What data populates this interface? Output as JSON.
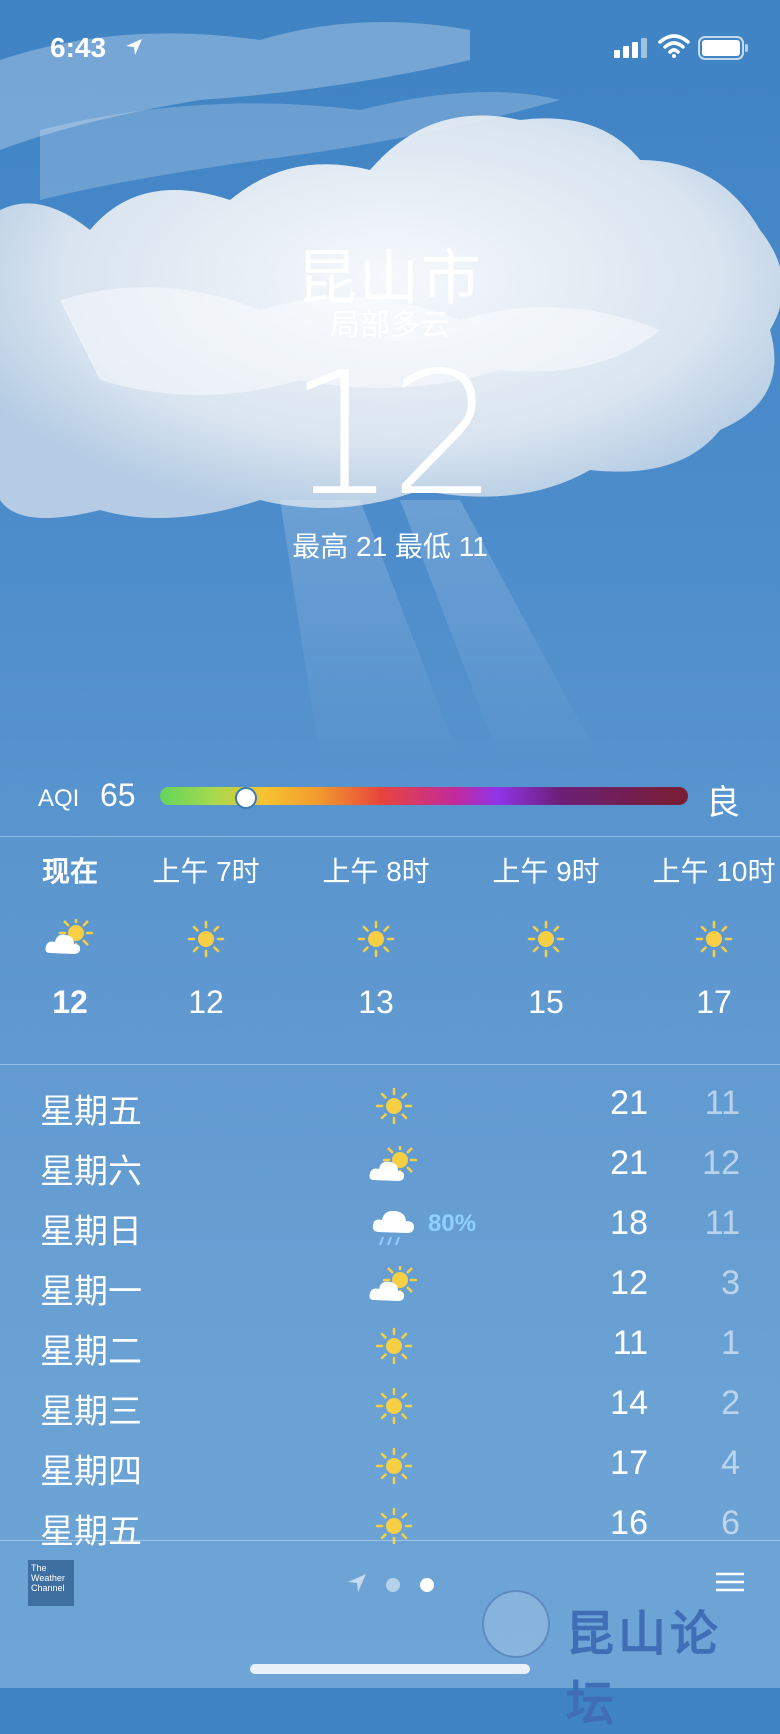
{
  "status_bar": {
    "time": "6:43"
  },
  "location": {
    "city": "昆山市",
    "condition": "局部多云",
    "temperature": "12",
    "hi_lo": "最高 21  最低 11"
  },
  "aqi": {
    "label": "AQI",
    "value": "65",
    "level": "良",
    "position": 0.16
  },
  "hourly": [
    {
      "label": "现在",
      "icon": "partly-cloudy-icon",
      "temp": "12",
      "bold": true
    },
    {
      "label": "上午 7时",
      "icon": "sun-icon",
      "temp": "12"
    },
    {
      "label": "上午 8时",
      "icon": "sun-icon",
      "temp": "13"
    },
    {
      "label": "上午 9时",
      "icon": "sun-icon",
      "temp": "15"
    },
    {
      "label": "上午 10时",
      "icon": "sun-icon",
      "temp": "17"
    }
  ],
  "daily": [
    {
      "day": "星期五",
      "icon": "sun-icon",
      "precip": "",
      "hi": "21",
      "lo": "11"
    },
    {
      "day": "星期六",
      "icon": "partly-cloudy-icon",
      "precip": "",
      "hi": "21",
      "lo": "12"
    },
    {
      "day": "星期日",
      "icon": "rain-icon",
      "precip": "80%",
      "hi": "18",
      "lo": "11"
    },
    {
      "day": "星期一",
      "icon": "partly-cloudy-icon",
      "precip": "",
      "hi": "12",
      "lo": "3"
    },
    {
      "day": "星期二",
      "icon": "sun-icon",
      "precip": "",
      "hi": "11",
      "lo": "1"
    },
    {
      "day": "星期三",
      "icon": "sun-icon",
      "precip": "",
      "hi": "14",
      "lo": "2"
    },
    {
      "day": "星期四",
      "icon": "sun-icon",
      "precip": "",
      "hi": "17",
      "lo": "4"
    },
    {
      "day": "星期五",
      "icon": "sun-icon",
      "precip": "",
      "hi": "16",
      "lo": "6"
    }
  ],
  "footer": {
    "weather_channel": "The Weather Channel",
    "watermark": "昆山论坛",
    "active_page": 2,
    "page_count": 2
  },
  "colors": {
    "sun": "#f6cf45",
    "cloud": "#ffffff",
    "precip": "#8fd0ff"
  }
}
